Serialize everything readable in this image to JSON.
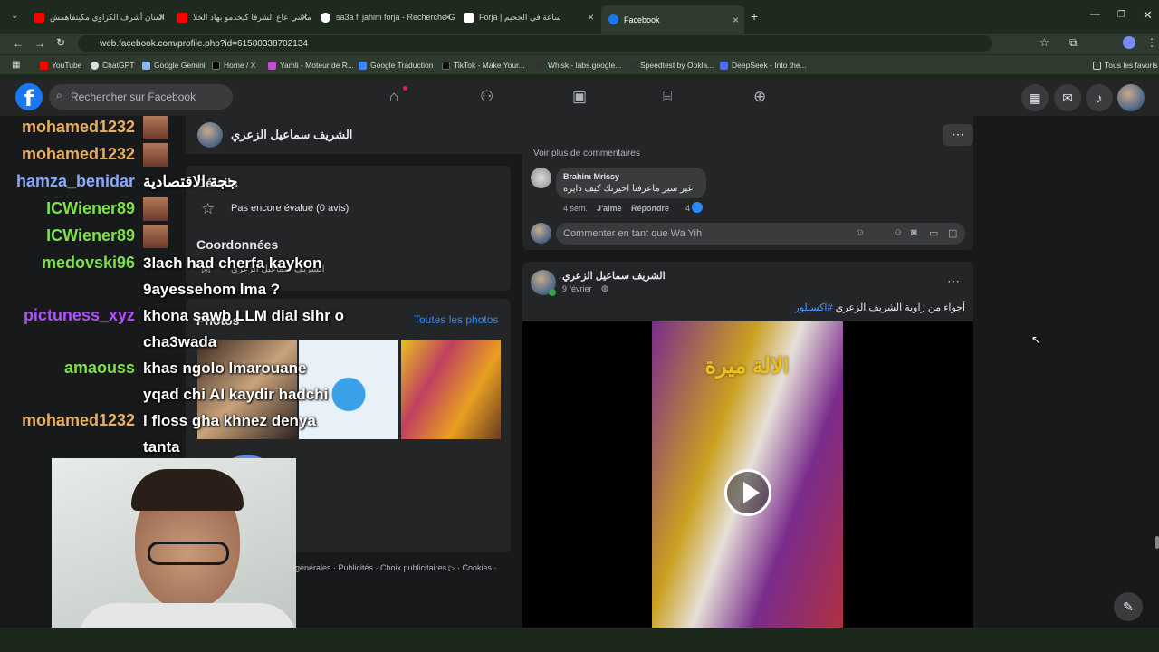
{
  "tabs": [
    {
      "title": "الفنان أشرف الكزاوي مكيتفاهمش",
      "active": false
    },
    {
      "title": "ماشي عاع الشرفا كيخدمو بهاد الخلا",
      "active": false
    },
    {
      "title": "sa3a fl jahim forja - Recherche G",
      "active": false
    },
    {
      "title": "Forja | ساعة في الجحيم",
      "active": false
    },
    {
      "title": "Facebook",
      "active": true
    }
  ],
  "address": "web.facebook.com/profile.php?id=61580338702134",
  "bookmarks": [
    "YouTube",
    "ChatGPT",
    "Google Gemini",
    "Home / X",
    "Yamli - Moteur de R...",
    "Google Traduction",
    "TikTok - Make Your...",
    "Whisk - labs.google...",
    "Speedtest by Ookla...",
    "DeepSeek - Into the..."
  ],
  "bookmarks_all": "Tous les favoris",
  "fb": {
    "search_placeholder": "Rechercher sur Facebook",
    "profile_name": "الشريف سماعيل الزعري",
    "details_title": "Détails",
    "rating": "Pas encore évalué (0 avis)",
    "contact_title": "Coordonnées",
    "contact_name": "الشريف سماعيل الزعري",
    "photos_title": "Photos",
    "photos_link": "Toutes les photos",
    "footer_links": "générales · Publicités · Choix publicitaires ▷ · Cookies ·",
    "more_comments": "Voir plus de commentaires",
    "comment": {
      "author": "Brahim Mrissy",
      "text": "غير سير ماعرفنا اخيرتك كيف دايره",
      "age": "4 sem.",
      "like": "J'aime",
      "reply": "Répondre",
      "reactions": "4"
    },
    "comment_placeholder": "Commenter en tant que Wa Yih",
    "post": {
      "author": "الشريف سماعيل الزعري",
      "date": "9 février",
      "hashtag": "#اكسبلور",
      "text": "أجواء من زاوية الشريف الزعري",
      "video_caption": "الالة ميرة"
    }
  },
  "chat": [
    {
      "user": "mohamed1232",
      "color": "#e8b060",
      "msg": ""
    },
    {
      "user": "mohamed1232",
      "color": "#e8b060",
      "msg": ""
    },
    {
      "user": "hamza_benidar",
      "color": "#8aa8ff",
      "msg": "ججة الاقتصادية"
    },
    {
      "user": "ICWiener89",
      "color": "#7ee04a",
      "msg": ""
    },
    {
      "user": "ICWiener89",
      "color": "#7ee04a",
      "msg": ""
    },
    {
      "user": "medovski96",
      "color": "#7ee04a",
      "msg": "3lach had cherfa kaykon 9ayessehom lma ?"
    },
    {
      "user": "pictuness_xyz",
      "color": "#b050ff",
      "msg": "khona sawb LLM dial sihr o cha3wada"
    },
    {
      "user": "amaouss",
      "color": "#7ee04a",
      "msg": "khas ngolo lmarouane yqad chi AI kaydir hadchi"
    },
    {
      "user": "mohamed1232",
      "color": "#e8b060",
      "msg": "l floss gha khnez denya tanta"
    }
  ]
}
